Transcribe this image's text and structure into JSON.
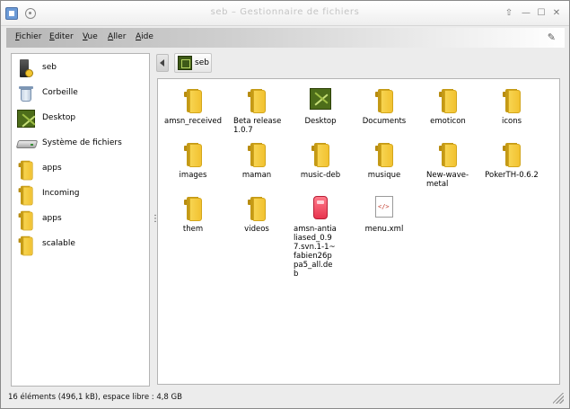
{
  "window": {
    "title": "seb – Gestionnaire de fichiers",
    "buttons": [
      "keep-above",
      "minimize",
      "maximize",
      "close"
    ]
  },
  "menubar": {
    "items": [
      "Fichier",
      "Editer",
      "Vue",
      "Aller",
      "Aide"
    ]
  },
  "places": [
    {
      "label": "seb",
      "icon": "home-icon"
    },
    {
      "label": "Corbeille",
      "icon": "trash-icon"
    },
    {
      "label": "Desktop",
      "icon": "desktop-icon"
    },
    {
      "label": "Système de fichiers",
      "icon": "drive-icon"
    },
    {
      "label": "apps",
      "icon": "folder-icon"
    },
    {
      "label": "Incoming",
      "icon": "folder-icon"
    },
    {
      "label": "apps",
      "icon": "folder-icon"
    },
    {
      "label": "scalable",
      "icon": "folder-icon"
    }
  ],
  "breadcrumb": {
    "current": "seb"
  },
  "files": [
    {
      "label": "amsn_received",
      "type": "folder"
    },
    {
      "label": "Beta release 1.0.7",
      "type": "folder"
    },
    {
      "label": "Desktop",
      "type": "desktop"
    },
    {
      "label": "Documents",
      "type": "folder"
    },
    {
      "label": "emoticon",
      "type": "folder"
    },
    {
      "label": "icons",
      "type": "folder"
    },
    {
      "label": "images",
      "type": "folder"
    },
    {
      "label": "maman",
      "type": "folder"
    },
    {
      "label": "music-deb",
      "type": "folder"
    },
    {
      "label": "musique",
      "type": "folder"
    },
    {
      "label": "New-wave-metal",
      "type": "folder"
    },
    {
      "label": "PokerTH-0.6.2",
      "type": "folder"
    },
    {
      "label": "them",
      "type": "folder"
    },
    {
      "label": "videos",
      "type": "folder"
    },
    {
      "label": "amsn-antialiased_0.97.svn.1-1~fabien26ppa5_all.deb",
      "type": "deb"
    },
    {
      "label": "menu.xml",
      "type": "xml"
    }
  ],
  "statusbar": {
    "text": "16 éléments (496,1 kB), espace libre : 4,8 GB"
  }
}
